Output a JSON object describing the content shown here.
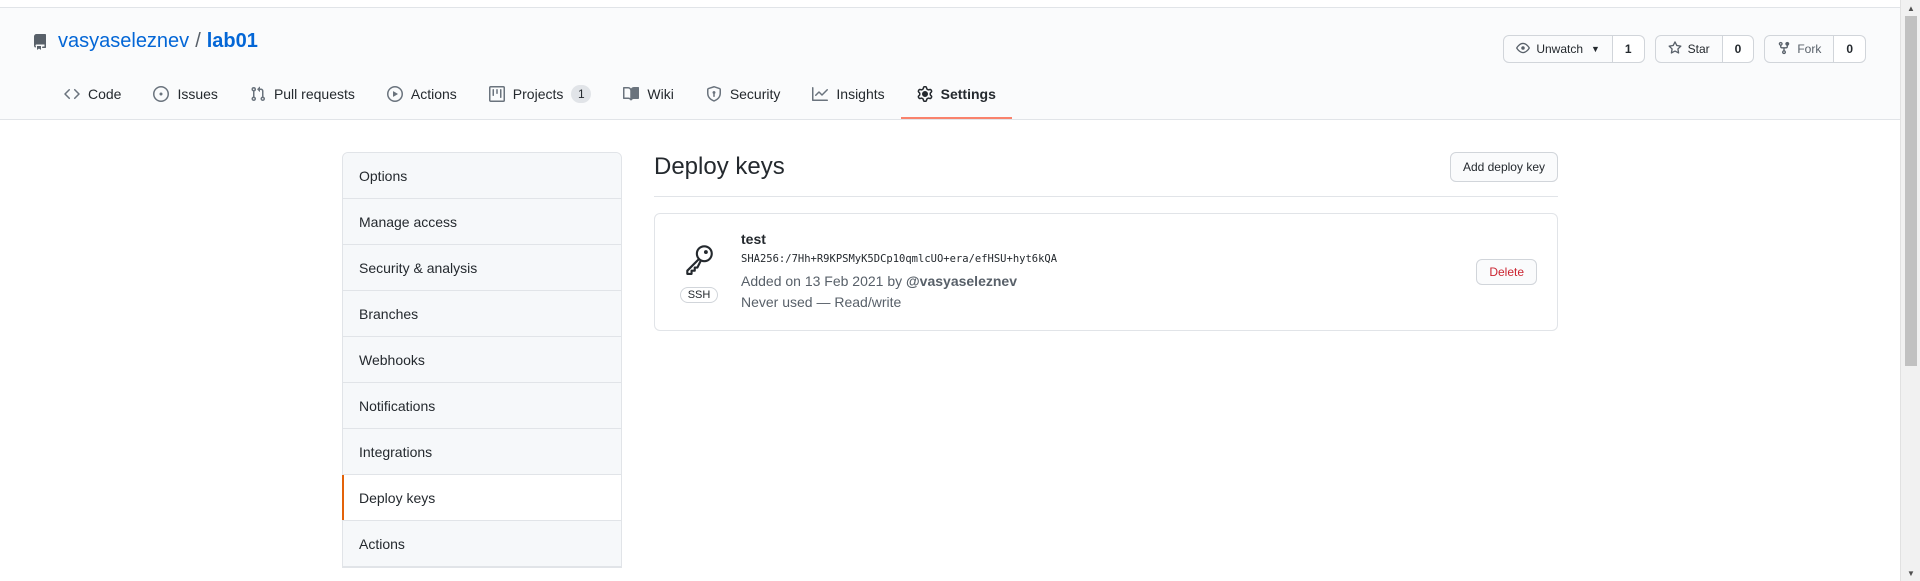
{
  "repo": {
    "owner": "vasyaseleznev",
    "separator": "/",
    "name": "lab01"
  },
  "repo_actions": {
    "watch": {
      "label": "Unwatch",
      "count": "1"
    },
    "star": {
      "label": "Star",
      "count": "0"
    },
    "fork": {
      "label": "Fork",
      "count": "0"
    }
  },
  "tabs": [
    {
      "label": "Code",
      "icon": "code-icon"
    },
    {
      "label": "Issues",
      "icon": "issue-icon"
    },
    {
      "label": "Pull requests",
      "icon": "pull-request-icon"
    },
    {
      "label": "Actions",
      "icon": "play-icon"
    },
    {
      "label": "Projects",
      "icon": "project-icon",
      "counter": "1"
    },
    {
      "label": "Wiki",
      "icon": "book-icon"
    },
    {
      "label": "Security",
      "icon": "shield-icon"
    },
    {
      "label": "Insights",
      "icon": "graph-icon"
    },
    {
      "label": "Settings",
      "icon": "gear-icon",
      "selected": true
    }
  ],
  "settings_menu": [
    {
      "label": "Options"
    },
    {
      "label": "Manage access"
    },
    {
      "label": "Security & analysis"
    },
    {
      "label": "Branches"
    },
    {
      "label": "Webhooks"
    },
    {
      "label": "Notifications"
    },
    {
      "label": "Integrations"
    },
    {
      "label": "Deploy keys",
      "selected": true
    },
    {
      "label": "Actions"
    }
  ],
  "deploy_keys": {
    "title": "Deploy keys",
    "add_button": "Add deploy key",
    "keys": [
      {
        "title": "test",
        "type": "SSH",
        "fingerprint": "SHA256:/7Hh+R9KPSMyK5DCp10qmlcUO+era/efHSU+hyt6kQA",
        "added_prefix": "Added on 13 Feb 2021 by ",
        "added_by": "@vasyaseleznev",
        "usage": "Never used — Read/write",
        "delete_label": "Delete"
      }
    ]
  },
  "colors": {
    "link": "#0366d6",
    "selected_tab_underline": "#f9826c",
    "danger": "#cb2431"
  }
}
